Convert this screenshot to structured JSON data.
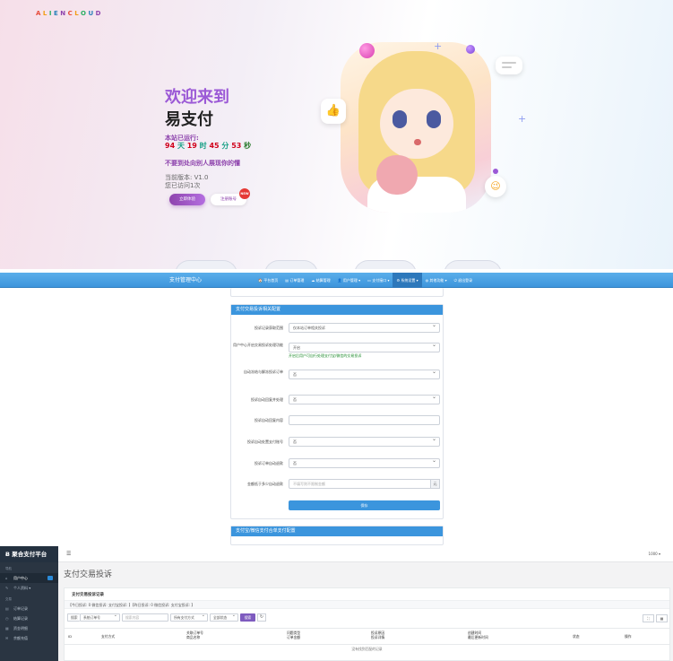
{
  "hero": {
    "logo": [
      "A",
      "L",
      "I",
      "E",
      "N",
      "C",
      "L",
      "O",
      "U",
      "D"
    ],
    "title_line1": "欢迎来到",
    "title_line2": "易支付",
    "run_label": "本站已运行:",
    "run_days": "94",
    "run_days_unit": "天",
    "run_hours": "19",
    "run_hours_unit": "时",
    "run_minutes": "45",
    "run_minutes_unit": "分",
    "run_seconds": "53",
    "run_seconds_unit": "秒",
    "slogan": "不要到处向别人展现你的懂",
    "version": "当前版本: V1.0",
    "visits": "您已访问1次",
    "pay_button": "立即体验",
    "register_button": "注册账号",
    "new_badge": "NEW",
    "colors": {
      "accent": "#8e44ad",
      "title": "#9b59d6",
      "runtime_num": "#d0021b"
    }
  },
  "navbar": {
    "brand": "支付管理中心",
    "items": [
      {
        "label": "🏠 平台首页",
        "active": false
      },
      {
        "label": "▤ 订单管理",
        "active": false
      },
      {
        "label": "☁ 结算管理",
        "active": false
      },
      {
        "label": "👤 用户管理 ▾",
        "active": false
      },
      {
        "label": "▭ 支付接口 ▾",
        "active": false
      },
      {
        "label": "⚙ 系统设置 ▾",
        "active": true
      },
      {
        "label": "◍ 其他功能 ▾",
        "active": false
      },
      {
        "label": "⏻ 退出登录",
        "active": false
      }
    ],
    "color": "#3d95dc"
  },
  "settings": {
    "card_title": "支付交易投诉相关配置",
    "fields": [
      {
        "label": "投诉记录获取范围",
        "value": "仅本站订单相关投诉",
        "type": "select"
      },
      {
        "label": "用户中心开启交易投诉处理功能",
        "value": "开启",
        "type": "select",
        "hint": "开启后用户可自行处理支付宝/微信的交易投诉"
      },
      {
        "label": "自动冻结与解冻投诉订单",
        "value": "否",
        "type": "select"
      },
      {
        "label": "投诉自动回复并处理",
        "value": "否",
        "type": "select"
      },
      {
        "label": "投诉自动回复内容",
        "value": "",
        "type": "text"
      },
      {
        "label": "投诉自动处置支付账号",
        "value": "否",
        "type": "select"
      },
      {
        "label": "投诉订单自动退款",
        "value": "否",
        "type": "select"
      },
      {
        "label": "金额低于多少自动退款",
        "value": "",
        "placeholder": "不填写则不限制金额",
        "type": "addon",
        "addon": "元"
      }
    ],
    "save_button": "保存",
    "next_card_title": "支付宝/微信支付合单支付配置"
  },
  "admin": {
    "brand": "聚合支付平台",
    "sections": [
      {
        "title": "导航",
        "items": [
          {
            "icon": "⌂",
            "label": "用户中心",
            "active": true
          },
          {
            "icon": "✎",
            "label": "个人资料 ▾",
            "active": false
          }
        ]
      },
      {
        "title": "交易",
        "items": [
          {
            "icon": "▤",
            "label": "订单记录",
            "active": false
          },
          {
            "icon": "◷",
            "label": "结算记录",
            "active": false
          },
          {
            "icon": "▦",
            "label": "资金明细",
            "active": false
          },
          {
            "icon": "✉",
            "label": "余额充值",
            "active": false
          }
        ]
      }
    ],
    "user_menu": "1000 ▾",
    "page_title": "支付交易投诉",
    "panel_title": "支付交易投诉记录",
    "panel_info": "【今日投诉: 0 微信投诉: 支付宝投诉: 】【昨日投诉: 0 微信投诉: 支付宝投诉: 】",
    "filters": {
      "search_type": "搜索",
      "order_type": "系统订单号",
      "search_placeholder": "搜索内容",
      "pay_method": "所有支付方式",
      "status": "全部状态",
      "search_button": "搜索",
      "refresh_icon": "↻"
    },
    "table_headers": [
      {
        "line1": "ID",
        "line2": ""
      },
      {
        "line1": "支付方式",
        "line2": ""
      },
      {
        "line1": "关联订单号",
        "line2": "商品名称"
      },
      {
        "line1": "问题类型",
        "line2": "订单金额"
      },
      {
        "line1": "投诉原因",
        "line2": "投诉详情"
      },
      {
        "line1": "创建时间",
        "line2": "最后更新时间"
      },
      {
        "line1": "状态",
        "line2": ""
      },
      {
        "line1": "操作",
        "line2": ""
      }
    ],
    "empty_message": "没有找到匹配的记录"
  }
}
